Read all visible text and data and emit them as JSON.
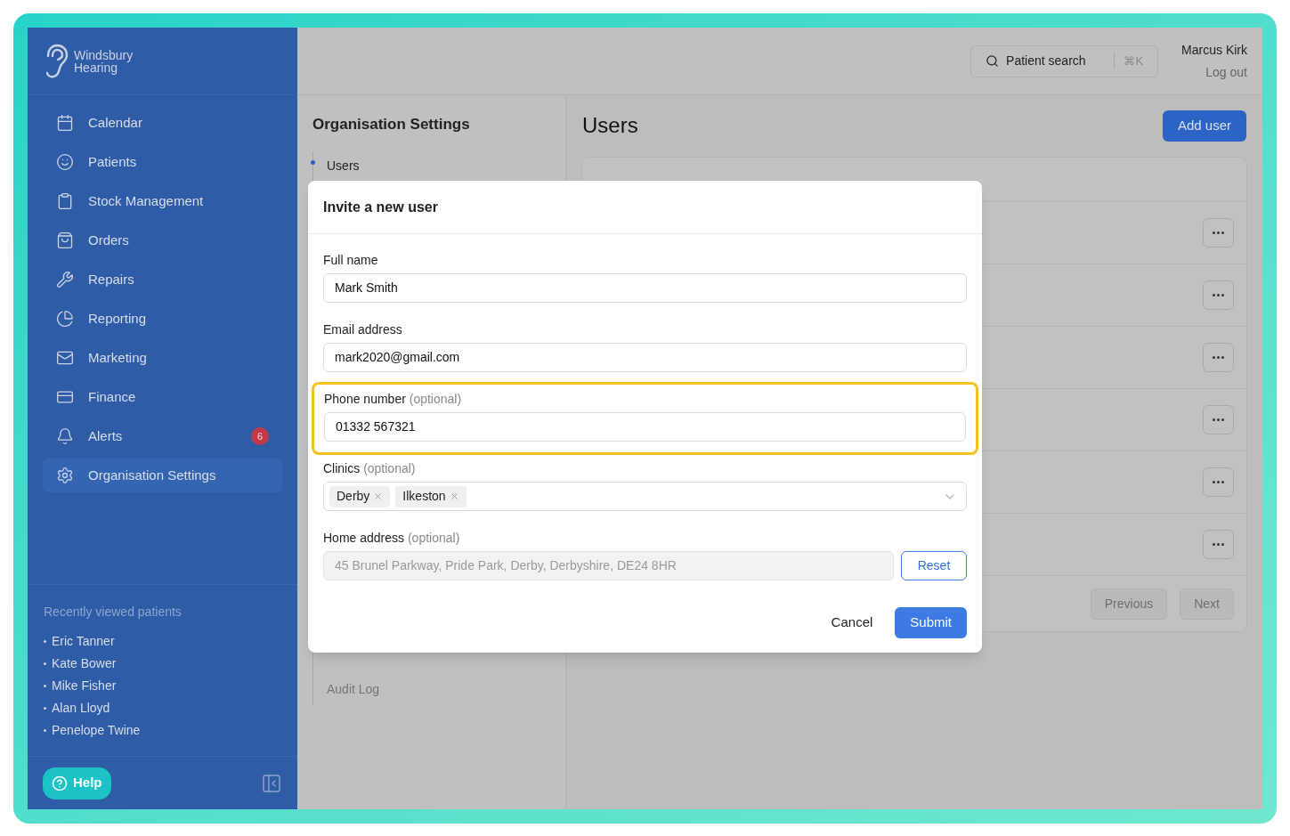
{
  "sidebar": {
    "logo": {
      "line1": "Windsbury",
      "line2": "Hearing"
    },
    "nav": [
      {
        "label": "Calendar",
        "selected": false
      },
      {
        "label": "Patients",
        "selected": false
      },
      {
        "label": "Stock Management",
        "selected": false
      },
      {
        "label": "Orders",
        "selected": false
      },
      {
        "label": "Repairs",
        "selected": false
      },
      {
        "label": "Reporting",
        "selected": false
      },
      {
        "label": "Marketing",
        "selected": false
      },
      {
        "label": "Finance",
        "selected": false
      },
      {
        "label": "Alerts",
        "selected": false,
        "badge": "6"
      },
      {
        "label": "Organisation Settings",
        "selected": true
      }
    ],
    "recent": {
      "title": "Recently viewed patients",
      "patients": [
        "Eric Tanner",
        "Kate Bower",
        "Mike Fisher",
        "Alan Lloyd",
        "Penelope Twine"
      ]
    },
    "help": "Help"
  },
  "header": {
    "search": {
      "label": "Patient search",
      "shortcut": "⌘K"
    },
    "user": {
      "name": "Marcus Kirk",
      "logout": "Log out"
    }
  },
  "settings_nav": {
    "title": "Organisation Settings",
    "items": [
      {
        "label": "Users",
        "selected": true
      },
      {
        "label": "Audit Log",
        "selected": false
      }
    ]
  },
  "users": {
    "title": "Users",
    "add_button": "Add user",
    "rows": [
      {
        "kind": "user"
      },
      {
        "kind": "user"
      },
      {
        "kind": "user"
      },
      {
        "kind": "user"
      },
      {
        "kind": "user"
      },
      {
        "kind": "user"
      }
    ],
    "previous": {
      "label": "Previous",
      "disabled": true
    },
    "next": {
      "label": "Next",
      "disabled": true
    }
  },
  "modal": {
    "title": "Invite a new user",
    "fields": [
      {
        "kind": "text",
        "label": "Full name",
        "value": "Mark Smith",
        "highlighted": false
      },
      {
        "kind": "text",
        "label": "Email address",
        "value": "mark2020@gmail.com",
        "highlighted": false
      },
      {
        "kind": "text",
        "label": "Phone number",
        "hint": "(optional)",
        "value": "01332 567321",
        "highlighted": true
      },
      {
        "kind": "multiselect",
        "label": "Clinics",
        "hint": "(optional)",
        "chips": [
          "Derby",
          "Ilkeston"
        ],
        "highlighted": false
      },
      {
        "kind": "address",
        "label": "Home address",
        "hint": "(optional)",
        "value": "45 Brunel Parkway, Pride Park, Derby, Derbyshire, DE24 8HR",
        "disabled": true,
        "reset": "Reset",
        "highlighted": false
      }
    ],
    "cancel": "Cancel",
    "submit": "Submit"
  }
}
